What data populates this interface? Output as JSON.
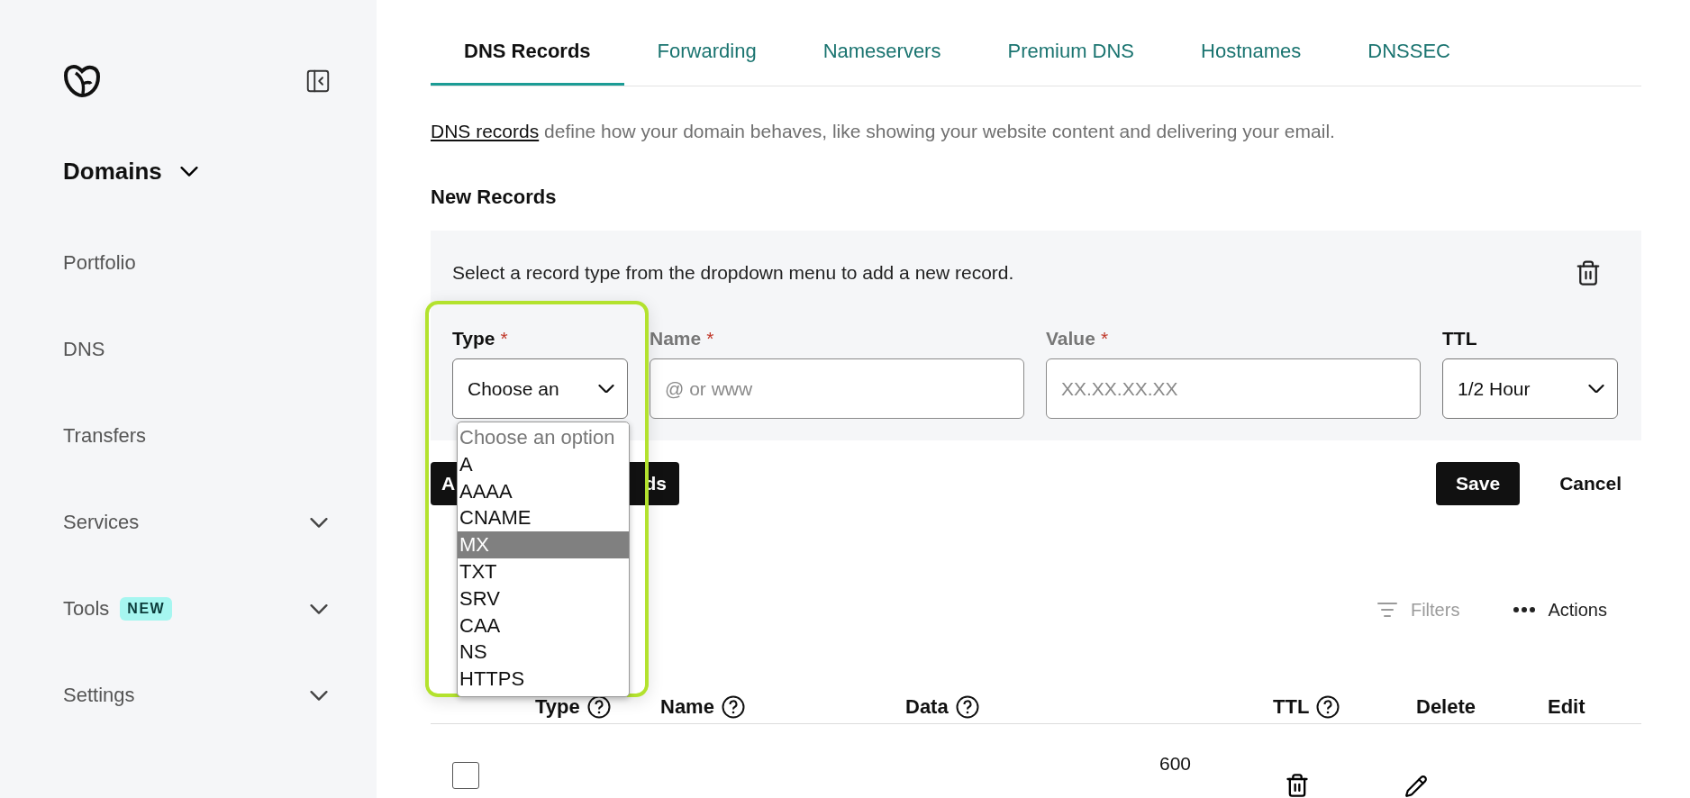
{
  "sidebar": {
    "section": {
      "label": "Domains",
      "expanded": true
    },
    "items": [
      {
        "label": "Portfolio",
        "expandable": false
      },
      {
        "label": "DNS",
        "expandable": false
      },
      {
        "label": "Transfers",
        "expandable": false
      },
      {
        "label": "Services",
        "expandable": true
      },
      {
        "label": "Tools",
        "expandable": true,
        "badge": "NEW"
      },
      {
        "label": "Settings",
        "expandable": true
      }
    ]
  },
  "tabs": [
    {
      "label": "DNS Records",
      "selected": true
    },
    {
      "label": "Forwarding",
      "selected": false
    },
    {
      "label": "Nameservers",
      "selected": false
    },
    {
      "label": "Premium DNS",
      "selected": false
    },
    {
      "label": "Hostnames",
      "selected": false
    },
    {
      "label": "DNSSEC",
      "selected": false
    }
  ],
  "description": {
    "link": "DNS records",
    "text": "define how your domain behaves, like showing your website content and delivering your email."
  },
  "new_records": {
    "title": "New Records",
    "instruction": "Select a record type from the dropdown menu to add a new record.",
    "fields": [
      {
        "kind": "select",
        "label": "Type",
        "required_mark": "*",
        "disabled": false,
        "value": "Choose an"
      },
      {
        "kind": "input",
        "label": "Name",
        "required_mark": "*",
        "disabled": true,
        "placeholder": "@ or www"
      },
      {
        "kind": "input",
        "label": "Value",
        "required_mark": "*",
        "disabled": true,
        "placeholder": "XX.XX.XX.XX"
      },
      {
        "kind": "select",
        "label": "TTL",
        "disabled": false,
        "value": "1/2 Hour"
      }
    ],
    "type_options": [
      {
        "label": "Choose an option",
        "disabled": true,
        "selected": false
      },
      {
        "label": "A",
        "disabled": false,
        "selected": false
      },
      {
        "label": "AAAA",
        "disabled": false,
        "selected": false
      },
      {
        "label": "CNAME",
        "disabled": false,
        "selected": false
      },
      {
        "label": "MX",
        "disabled": false,
        "selected": true
      },
      {
        "label": "TXT",
        "disabled": false,
        "selected": false
      },
      {
        "label": "SRV",
        "disabled": false,
        "selected": false
      },
      {
        "label": "CAA",
        "disabled": false,
        "selected": false
      },
      {
        "label": "NS",
        "disabled": false,
        "selected": false
      },
      {
        "label": "HTTPS",
        "disabled": false,
        "selected": false
      }
    ],
    "add_button": {
      "label_start": "A",
      "label_end": "ds"
    },
    "save": "Save",
    "cancel": "Cancel"
  },
  "toolbar": [
    {
      "kind": "filters",
      "label": "Filters",
      "disabled": true
    },
    {
      "kind": "actions",
      "label": "Actions",
      "disabled": false
    }
  ],
  "table": {
    "columns": [
      {
        "label": "Type",
        "help": true
      },
      {
        "label": "Name",
        "help": true
      },
      {
        "label": "Data",
        "help": true
      },
      {
        "label": "TTL",
        "help": true
      },
      {
        "label": "Delete",
        "help": false
      },
      {
        "label": "Edit",
        "help": false
      }
    ],
    "rows": [
      {
        "ttl": "600",
        "checked": false
      }
    ]
  }
}
